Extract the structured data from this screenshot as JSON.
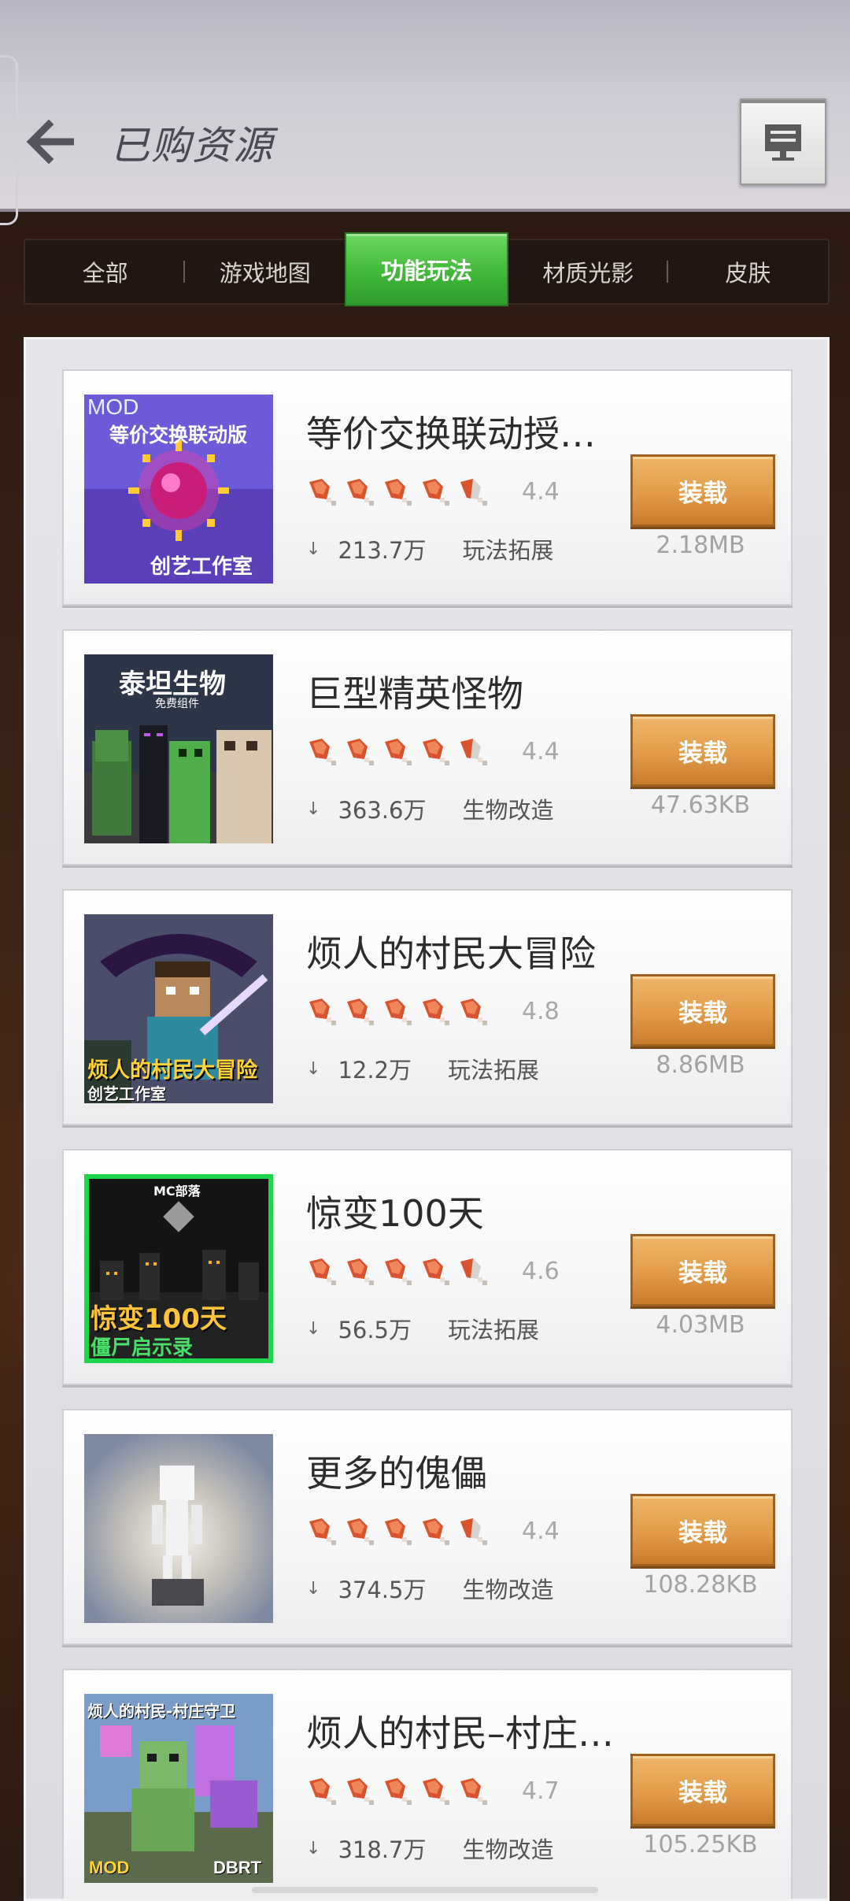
{
  "header": {
    "title": "已购资源",
    "back_icon": "arrow-left-icon",
    "feedback_icon": "monitor-feedback-icon"
  },
  "tabs": [
    {
      "label": "全部",
      "active": false
    },
    {
      "label": "游戏地图",
      "active": false
    },
    {
      "label": "功能玩法",
      "active": true
    },
    {
      "label": "材质光影",
      "active": false
    },
    {
      "label": "皮肤",
      "active": false
    }
  ],
  "items": [
    {
      "name": "等价交换联动授…",
      "rating": "4.4",
      "downloads": "213.7万",
      "category": "玩法拓展",
      "button": "装载",
      "size": "2.18MB",
      "thumb": {
        "top_label": "MOD",
        "banner": "等价交换联动版",
        "caption": "创艺工作室"
      }
    },
    {
      "name": "巨型精英怪物",
      "rating": "4.4",
      "downloads": "363.6万",
      "category": "生物改造",
      "button": "装载",
      "size": "47.63KB",
      "thumb": {
        "title": "泰坦生物",
        "sub": "免费组件"
      }
    },
    {
      "name": "烦人的村民大冒险",
      "rating": "4.8",
      "downloads": "12.2万",
      "category": "玩法拓展",
      "button": "装载",
      "size": "8.86MB",
      "thumb": {
        "title": "烦人的村民大冒险",
        "sub": "创艺工作室"
      }
    },
    {
      "name": "惊变100天",
      "rating": "4.6",
      "downloads": "56.5万",
      "category": "玩法拓展",
      "button": "装载",
      "size": "4.03MB",
      "thumb": {
        "top_label": "MC部落",
        "title": "惊变100天",
        "sub": "僵尸启示录"
      }
    },
    {
      "name": "更多的傀儡",
      "rating": "4.4",
      "downloads": "374.5万",
      "category": "生物改造",
      "button": "装载",
      "size": "108.28KB",
      "thumb": {}
    },
    {
      "name": "烦人的村民–村庄…",
      "rating": "4.7",
      "downloads": "318.7万",
      "category": "生物改造",
      "button": "装载",
      "size": "105.25KB",
      "thumb": {
        "title": "烦人的村民-村庄守卫",
        "left": "MOD",
        "right": "DBRT"
      }
    }
  ],
  "colors": {
    "tab_active": "#42b83a",
    "install_button": "#e29b48",
    "drumstick": "#d9532e"
  }
}
